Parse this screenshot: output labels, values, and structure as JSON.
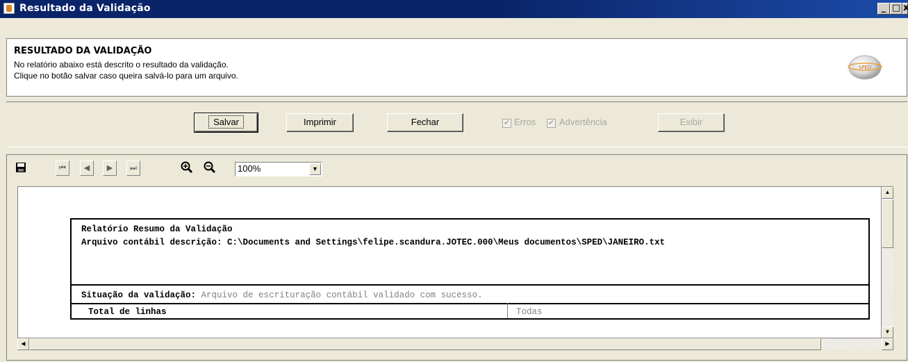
{
  "window": {
    "title": "Resultado da Validação",
    "minimize": "_",
    "maximize": "□",
    "close": "x"
  },
  "header": {
    "title": "RESULTADO DA VALIDAÇÃO",
    "line1": "No relatório abaixo está descrito o resultado da validação.",
    "line2": "Clique no botão salvar caso queira salvá-lo para um arquivo.",
    "logo_text": "SPED"
  },
  "toolbar": {
    "save_label": "Salvar",
    "print_label": "Imprimir",
    "close_label": "Fechar",
    "errors_label": "Erros",
    "errors_checked": true,
    "warnings_label": "Advertência",
    "warnings_checked": true,
    "show_label": "Exibir"
  },
  "viewer": {
    "zoom": "100%"
  },
  "report": {
    "title": "Relatório Resumo da Validação",
    "file_line": "Arquivo contábil descrição: C:\\Documents and Settings\\felipe.scandura.JOTEC.000\\Meus documentos\\SPED\\JANEIRO.txt",
    "status_label": "Situação da validação:",
    "status_value": "Arquivo de escrituração contábil validado com sucesso.",
    "total_label": "Total de linhas",
    "total_value": "Todas"
  },
  "colors": {
    "titlebar": "#0a246a",
    "face": "#ece9d8"
  }
}
